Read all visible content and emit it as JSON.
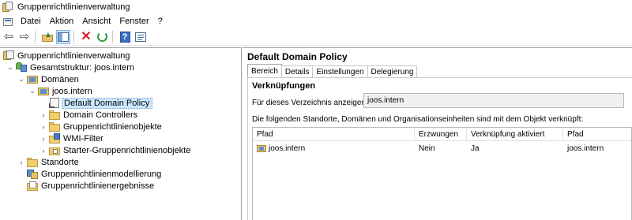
{
  "window": {
    "title": "Gruppenrichtlinienverwaltung"
  },
  "menu": [
    "Datei",
    "Aktion",
    "Ansicht",
    "Fenster",
    "?"
  ],
  "toolbar": {
    "icons": [
      "back-arrow-icon",
      "forward-arrow-icon",
      "folder-up-icon",
      "show-hide-tree-icon",
      "delete-icon",
      "refresh-icon",
      "help-icon",
      "properties-icon"
    ],
    "back_glyph": "⇦",
    "forward_glyph": "⇨",
    "delete_glyph": "✕",
    "help_glyph": "?"
  },
  "tree": {
    "expander_expanded": "⌄",
    "expander_collapsed": "›",
    "root": "Gruppenrichtlinienverwaltung",
    "forest": "Gesamtstruktur: joos.intern",
    "domains": "Domänen",
    "domain": "joos.intern",
    "children": [
      "Default Domain Policy",
      "Domain Controllers",
      "Gruppenrichtlinienobjekte",
      "WMI-Filter",
      "Starter-Gruppenrichtlinienobjekte"
    ],
    "sites": "Standorte",
    "modeling": "Gruppenrichtlinienmodellierung",
    "results": "Gruppenrichtlinienergebnisse"
  },
  "details": {
    "title": "Default Domain Policy",
    "tabs": [
      "Bereich",
      "Details",
      "Einstellungen",
      "Delegierung"
    ],
    "active_tab": "Bereich",
    "section": "Verknüpfungen",
    "scope_label": "Für dieses Verzeichnis anzeigen:",
    "scope_value": "joos.intern",
    "info_text": "Die folgenden Standorte, Domänen und Organisationseinheiten sind mit dem Objekt verknüpft:",
    "columns": [
      "Pfad",
      "Erzwungen",
      "Verknüpfung aktiviert",
      "Pfad"
    ],
    "rows": [
      {
        "path": "joos.intern",
        "enforced": "Nein",
        "link_enabled": "Ja",
        "path2": "joos.intern"
      }
    ]
  },
  "colors": {
    "selection": "#cce8ff",
    "toolbar_active": "#cce4f7"
  }
}
